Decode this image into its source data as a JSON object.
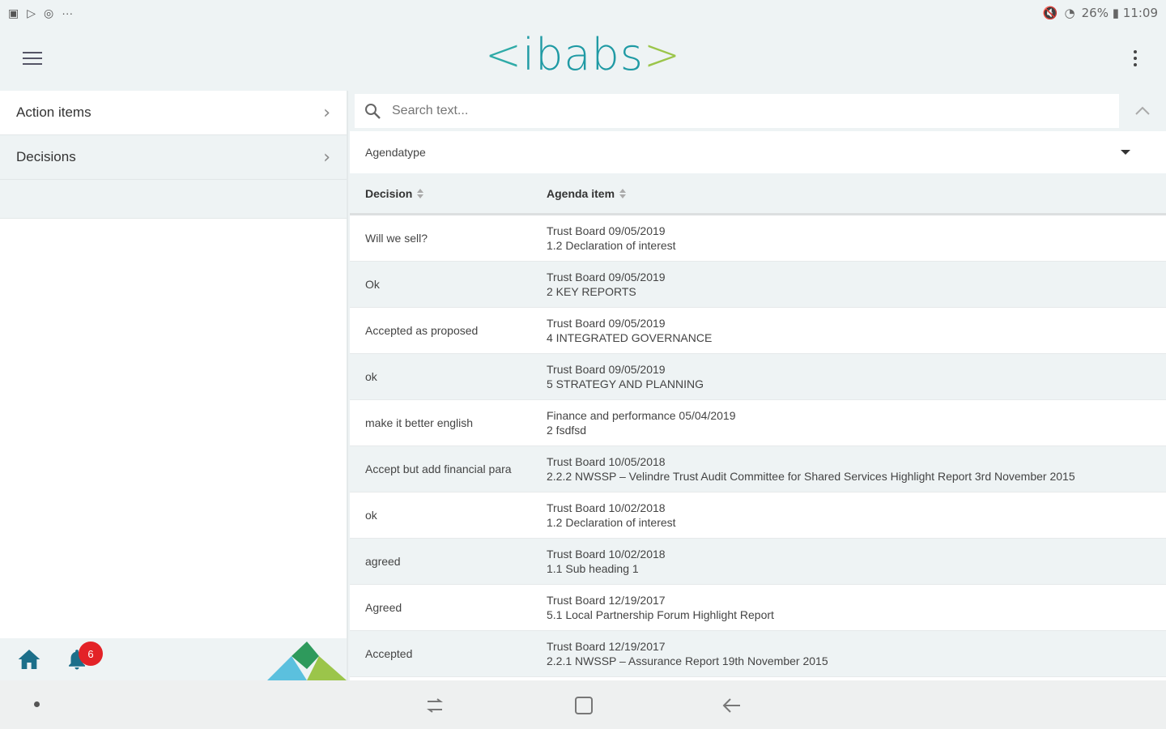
{
  "status": {
    "right_text": "26% ▮ 11:09"
  },
  "header": {
    "logo": {
      "left": "<",
      "text": "ibabs",
      "right": ">"
    }
  },
  "sidebar": {
    "items": [
      {
        "label": "Action items"
      },
      {
        "label": "Decisions"
      }
    ],
    "notification_count": "6"
  },
  "main": {
    "search": {
      "placeholder": "Search text..."
    },
    "filter": {
      "label": "Agendatype"
    },
    "table": {
      "headers": {
        "decision": "Decision",
        "agenda_item": "Agenda item"
      },
      "rows": [
        {
          "decision": "Will we sell?",
          "meeting": "Trust Board 09/05/2019",
          "item": "1.2 Declaration of interest"
        },
        {
          "decision": "Ok",
          "meeting": "Trust Board 09/05/2019",
          "item": "2 KEY REPORTS"
        },
        {
          "decision": "Accepted as proposed",
          "meeting": "Trust Board 09/05/2019",
          "item": "4 INTEGRATED GOVERNANCE"
        },
        {
          "decision": "ok",
          "meeting": "Trust Board 09/05/2019",
          "item": "5 STRATEGY AND PLANNING"
        },
        {
          "decision": "make it better english",
          "meeting": "Finance and performance 05/04/2019",
          "item": "2 fsdfsd"
        },
        {
          "decision": "Accept but add financial para",
          "meeting": "Trust Board 10/05/2018",
          "item": "2.2.2 NWSSP – Velindre Trust Audit Committee for Shared Services Highlight Report 3rd November 2015"
        },
        {
          "decision": "ok",
          "meeting": "Trust Board 10/02/2018",
          "item": "1.2 Declaration of interest"
        },
        {
          "decision": "agreed",
          "meeting": "Trust Board 10/02/2018",
          "item": "1.1 Sub heading 1"
        },
        {
          "decision": "Agreed",
          "meeting": "Trust Board 12/19/2017",
          "item": "5.1 Local Partnership Forum Highlight Report"
        },
        {
          "decision": "Accepted",
          "meeting": "Trust Board 12/19/2017",
          "item": "2.2.1 NWSSP – Assurance Report 19th November 2015"
        }
      ]
    }
  },
  "colors": {
    "accent": "#1f9aa4",
    "logo_green": "#9bc54a",
    "badge": "#e32227",
    "home_icon": "#1c6f8a"
  },
  "icons": [
    "menu-icon",
    "more-vert-icon",
    "search-icon",
    "chevron-up-icon",
    "chevron-right-icon",
    "home-icon",
    "bell-icon",
    "recent-apps-icon",
    "home-square-icon",
    "back-arrow-icon"
  ]
}
